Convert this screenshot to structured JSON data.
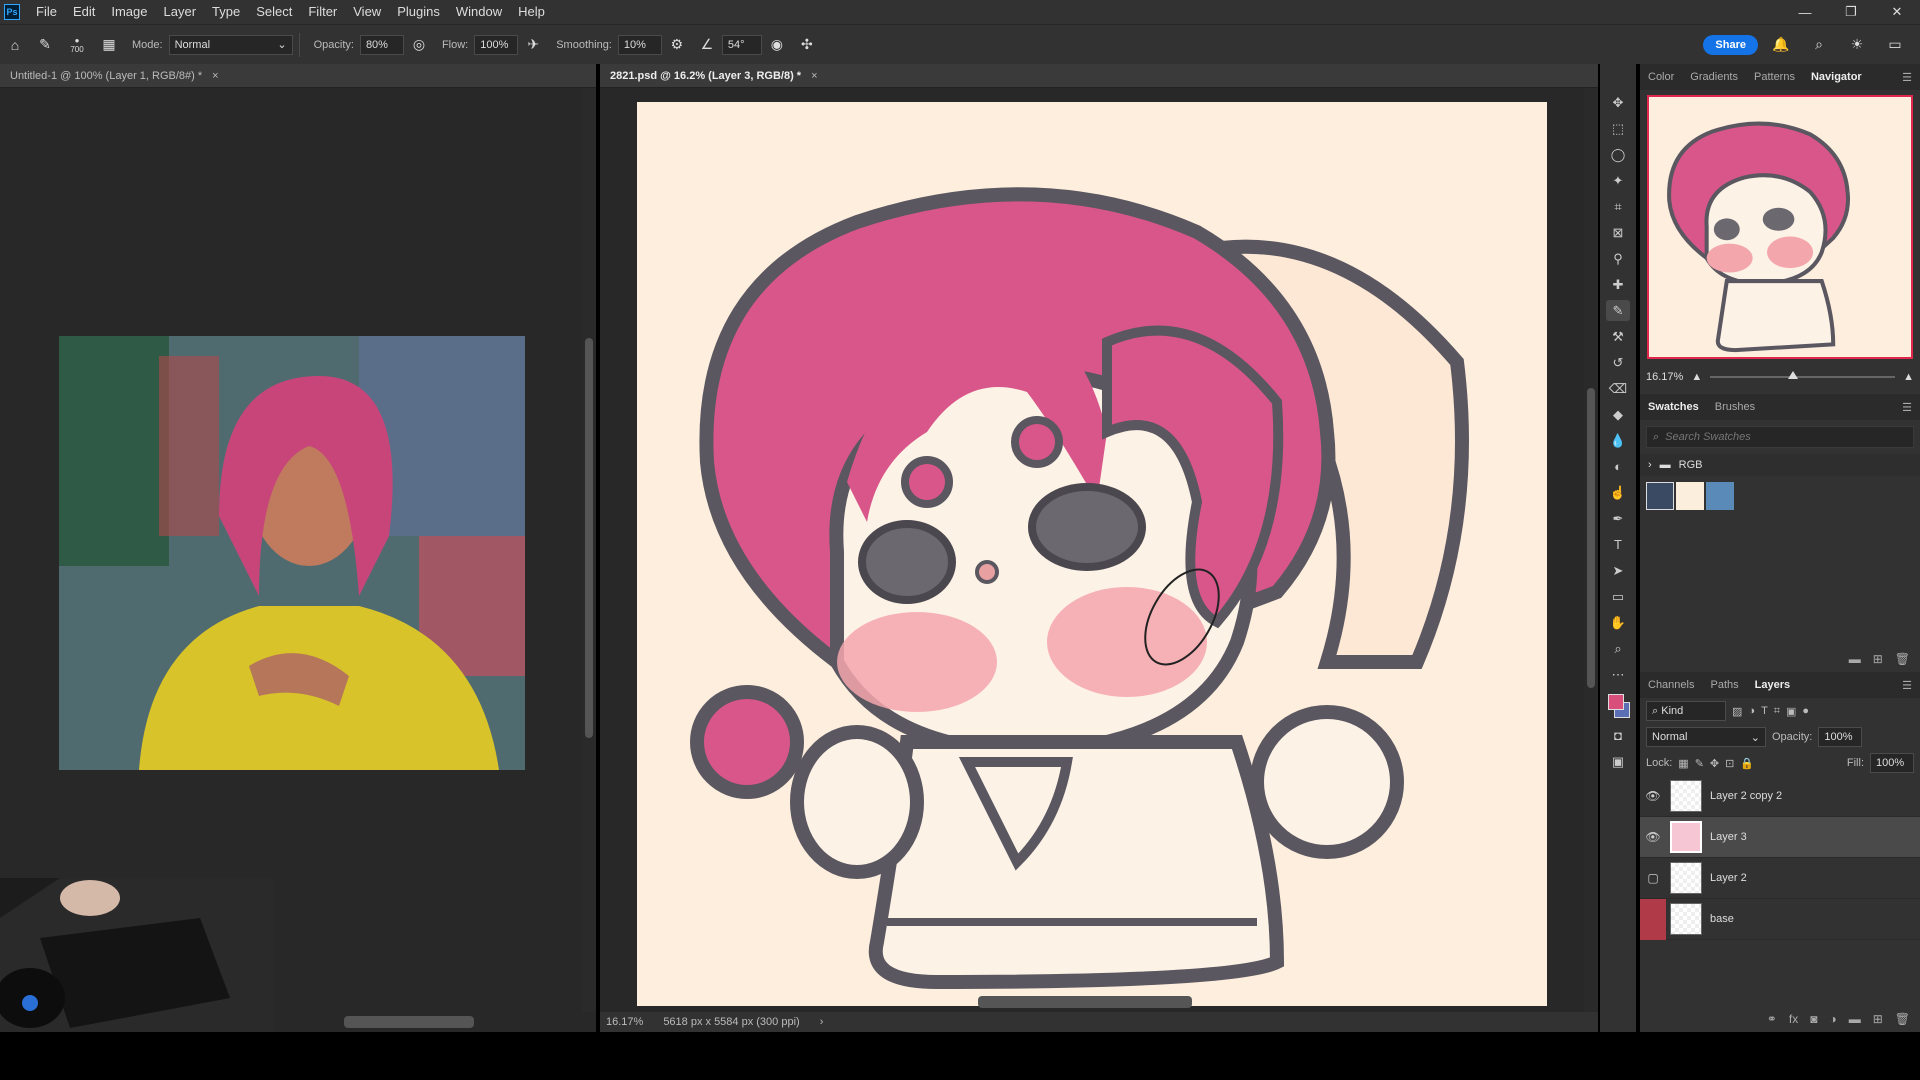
{
  "menubar": {
    "logo": "Ps",
    "items": [
      "File",
      "Edit",
      "Image",
      "Layer",
      "Type",
      "Select",
      "Filter",
      "View",
      "Plugins",
      "Window",
      "Help"
    ],
    "window_controls": [
      "—",
      "❐",
      "✕"
    ]
  },
  "options": {
    "brush_size": "700",
    "mode_label": "Mode:",
    "mode_value": "Normal",
    "opacity_label": "Opacity:",
    "opacity_value": "80%",
    "flow_label": "Flow:",
    "flow_value": "100%",
    "smoothing_label": "Smoothing:",
    "smoothing_value": "10%",
    "angle_value": "54°",
    "share_label": "Share"
  },
  "doc1": {
    "tab_title": "Untitled-1 @ 100% (Layer 1, RGB/8#) *",
    "close": "×"
  },
  "doc2": {
    "tab_title": "2821.psd @ 16.2% (Layer 3, RGB/8) *",
    "close": "×",
    "zoom": "16.17%",
    "doc_info": "5618 px x 5584 px (300 ppi)"
  },
  "navigator": {
    "tabs": [
      "Color",
      "Gradients",
      "Patterns",
      "Navigator"
    ],
    "active_tab": "Navigator",
    "zoom": "16.17%"
  },
  "swatches": {
    "tabs": [
      "Swatches",
      "Brushes"
    ],
    "search_placeholder": "Search Swatches",
    "group_name": "RGB",
    "colors": [
      "#3b4a63",
      "#fbeedd",
      "#5a8ab8"
    ]
  },
  "layers": {
    "tabs": [
      "Channels",
      "Paths",
      "Layers"
    ],
    "filter_kind": "Kind",
    "blend_mode": "Normal",
    "opacity_label": "Opacity:",
    "opacity_value": "100%",
    "lock_label": "Lock:",
    "fill_label": "Fill:",
    "fill_value": "100%",
    "items": [
      {
        "name": "Layer 2 copy 2",
        "visible": true,
        "selected": false
      },
      {
        "name": "Layer 3",
        "visible": true,
        "selected": true
      },
      {
        "name": "Layer 2",
        "visible": false,
        "selected": false
      },
      {
        "name": "base",
        "visible": false,
        "selected": false
      }
    ]
  },
  "colors": {
    "foreground": "#d94f7c",
    "background": "#5b6fb5",
    "accent": "#1473e6"
  }
}
